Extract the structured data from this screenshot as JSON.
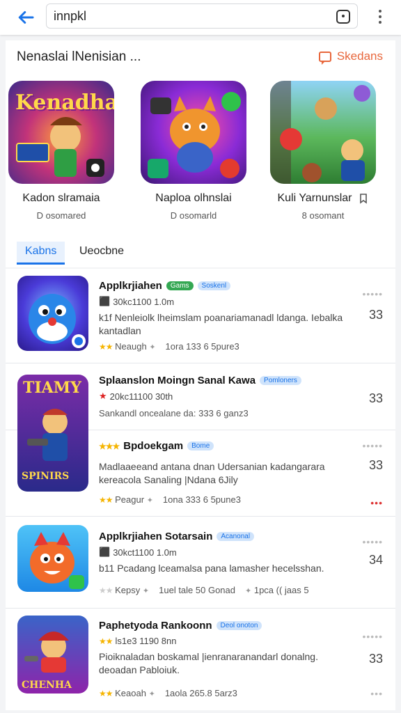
{
  "search": {
    "query": "innpkl"
  },
  "featured": {
    "title": "Nenaslai lNenisian ...",
    "link_label": "Skedans",
    "items": [
      {
        "name": "Kadon slramaia",
        "sub": "D osomared",
        "art_text": "Kenadha"
      },
      {
        "name": "Naploa olhnslai",
        "sub": "D osomarld",
        "art_text": ""
      },
      {
        "name": "Kuli Yarnunslar",
        "sub": "8 osomant",
        "art_text": ""
      }
    ]
  },
  "tabs": [
    {
      "label": "Kabns",
      "active": true
    },
    {
      "label": "Ueocbne",
      "active": false
    }
  ],
  "list": [
    {
      "title": "Applkrjiahen",
      "tags": [
        {
          "text": "Gams",
          "color": "green"
        },
        {
          "text": "Soskenl",
          "color": "blue"
        }
      ],
      "meta": "30kc1100 1.0m",
      "desc": "k1f Nenleiolk lheimslam poanariamanadl ldanga. Iebalka kantadlan",
      "foot": [
        "Neaugh",
        "1ora 133 6 5pure3"
      ],
      "score": "33",
      "dots": "•••••"
    },
    {
      "title": "Splaanslon Moingn Sanal Kawa",
      "tags": [
        {
          "text": "Pomloners",
          "color": "blue"
        }
      ],
      "meta": "20kc11100 30th",
      "desc": "",
      "foot": [
        "Sankandl oncealane da: 333 6 ganz3"
      ],
      "score": "33",
      "dots": ""
    },
    {
      "title": "Bpdoekgam",
      "tags": [
        {
          "text": "Bome",
          "color": "blue"
        }
      ],
      "meta": "",
      "desc": "Madlaaeeand antana dnan Udersanian kadangarara kereacola Sanaling |Ndana 6Jily",
      "foot": [
        "Peagur",
        "1ona 333 6 5pune3"
      ],
      "score": "33",
      "dots": "•••••"
    },
    {
      "title": "Applkrjiahen Sotarsain",
      "tags": [
        {
          "text": "Acanonal",
          "color": "blue"
        }
      ],
      "meta": "30kct1100 1.0m",
      "desc": "b11 Pcadang lceamalsa pana lamasher hecelsshan.",
      "foot": [
        "Kepsy",
        "1uel tale 50 Gonad",
        "1pca (( jaas 5"
      ],
      "score": "34",
      "dots": "•••••"
    },
    {
      "title": "Paphetyoda Rankoonn",
      "tags": [
        {
          "text": "Deol onoton",
          "color": "blue"
        }
      ],
      "meta": "ls1e3 1190 8nn",
      "desc": "Pioiknaladan boskamal |ienranaranandarl donalng. deoadan Pabloiuk.",
      "foot": [
        "Keaoah",
        "1aola 265.8 5arz3"
      ],
      "score": "33",
      "dots": "•••••"
    }
  ],
  "colors": {
    "accent": "#1a73e8",
    "link": "#e8673c",
    "star": "#f5b400"
  }
}
